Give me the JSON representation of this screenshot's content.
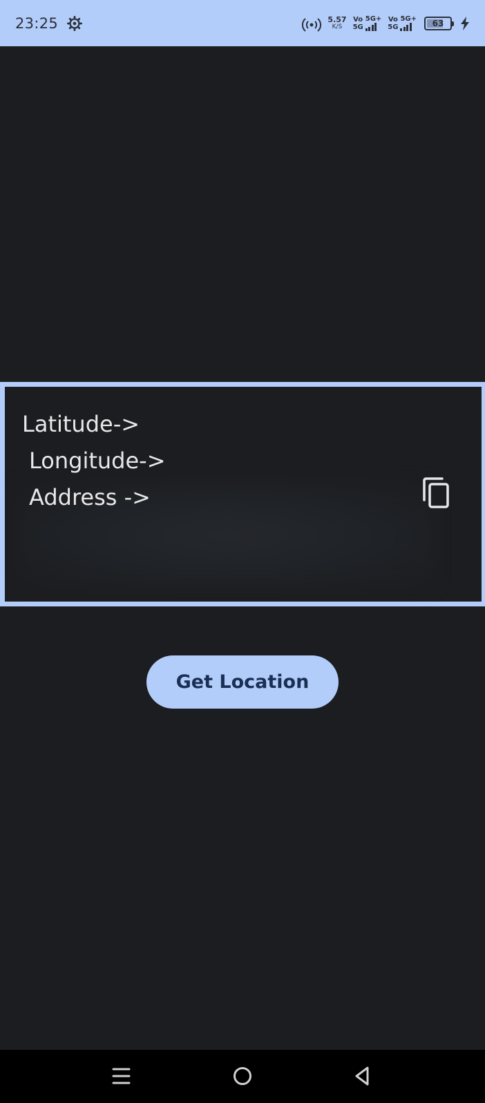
{
  "status_bar": {
    "time": "23:25",
    "settings_icon": "gear-icon",
    "hotspot_icon": "hotspot-icon",
    "net_speed_value": "5.57",
    "net_speed_unit": "K/S",
    "sim1": {
      "vo": "Vo",
      "vo_sub": "5G",
      "net": "5G+"
    },
    "sim2": {
      "vo": "Vo",
      "vo_sub": "5G",
      "net": "5G+"
    },
    "battery_level": "63",
    "charging_icon": "bolt-icon",
    "background_color": "#b3cdfb"
  },
  "location_card": {
    "latitude_label": "Latitude->",
    "longitude_label": "Longitude->",
    "address_label": "Address ->",
    "copy_icon": "copy-icon",
    "border_color": "#b3cdfb"
  },
  "actions": {
    "get_location_label": "Get Location",
    "button_color": "#b3cdfb"
  },
  "nav_bar": {
    "menu_icon": "menu-icon",
    "home_icon": "home-icon",
    "back_icon": "back-icon"
  },
  "theme": {
    "background": "#1c1d20",
    "text": "#e8e8ea"
  }
}
